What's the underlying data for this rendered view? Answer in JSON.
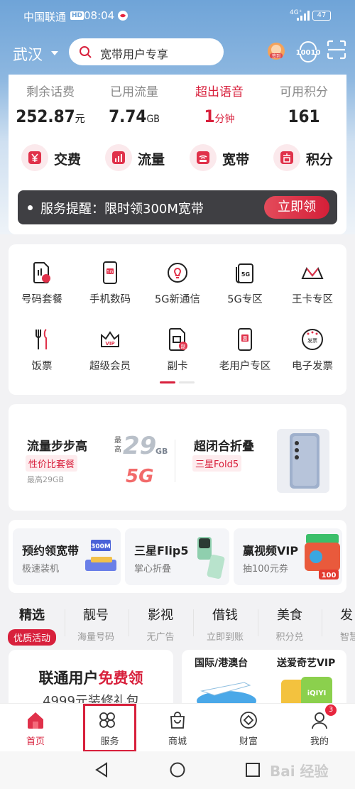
{
  "status_bar": {
    "carrier": "中国联通",
    "hd": "HD",
    "time": "08:04",
    "network": "4G⁺",
    "battery": "47"
  },
  "header": {
    "city": "武汉",
    "search_placeholder": "宽带用户专享",
    "checkin_label": "签到",
    "points_icon_text": "10010"
  },
  "stats": [
    {
      "label": "剩余话费",
      "value": "252.87",
      "unit": "元"
    },
    {
      "label": "已用流量",
      "value": "7.74",
      "unit": "GB"
    },
    {
      "label": "超出语音",
      "value": "1",
      "unit": "分钟"
    },
    {
      "label": "可用积分",
      "value": "161",
      "unit": ""
    }
  ],
  "quick_actions": [
    {
      "label": "交费",
      "icon": "yen-icon"
    },
    {
      "label": "流量",
      "icon": "bar-chart-icon"
    },
    {
      "label": "宽带",
      "icon": "router-icon"
    },
    {
      "label": "积分",
      "icon": "points-icon"
    }
  ],
  "notice": {
    "text": "服务提醒：限时领300M宽带",
    "button": "立即领"
  },
  "services": [
    {
      "label": "号码套餐"
    },
    {
      "label": "手机数码"
    },
    {
      "label": "5G新通信"
    },
    {
      "label": "5G专区"
    },
    {
      "label": "王卡专区"
    },
    {
      "label": "饭票"
    },
    {
      "label": "超级会员"
    },
    {
      "label": "副卡"
    },
    {
      "label": "老用户专区"
    },
    {
      "label": "电子发票"
    }
  ],
  "service_icon_text": {
    "5g_badge": "5G",
    "vip": "VIP",
    "fu": "副",
    "hui": "惠",
    "fapiao": "发票"
  },
  "promo": {
    "left": {
      "title": "流量步步高",
      "tag": "性价比套餐",
      "sub": "最高29GB",
      "art_top": "最",
      "art_bottom": "高",
      "art_num": "29",
      "art_unit": "GB",
      "art_5g": "5G"
    },
    "right": {
      "title": "超闭合折叠",
      "tag": "三星Fold5"
    }
  },
  "mini_promos": [
    {
      "title": "预约领宽带",
      "sub": "极速装机",
      "art": "300M"
    },
    {
      "title": "三星Flip5",
      "sub": "掌心折叠"
    },
    {
      "title": "赢视频VIP",
      "sub": "抽100元券",
      "art": "100"
    }
  ],
  "category_tabs": [
    {
      "title": "精选",
      "sub": "优质活动"
    },
    {
      "title": "靓号",
      "sub": "海量号码"
    },
    {
      "title": "影视",
      "sub": "无广告"
    },
    {
      "title": "借钱",
      "sub": "立即到账"
    },
    {
      "title": "美食",
      "sub": "积分兑"
    },
    {
      "title": "发",
      "sub": "智慧"
    }
  ],
  "feature_card": {
    "title_black": "联通用户",
    "title_red": "免费领",
    "sub": "4999元装修礼包"
  },
  "feature_card2": {
    "left": "国际/港澳台",
    "right": "送爱奇艺VIP",
    "art": "iQIYI"
  },
  "bottom_nav": [
    {
      "label": "首页"
    },
    {
      "label": "服务"
    },
    {
      "label": "商城"
    },
    {
      "label": "财富"
    },
    {
      "label": "我的",
      "badge": "3"
    }
  ],
  "watermark": "Bai 经验",
  "colors": {
    "accent": "#d8203c",
    "header_bg": "#6fa4d8"
  }
}
